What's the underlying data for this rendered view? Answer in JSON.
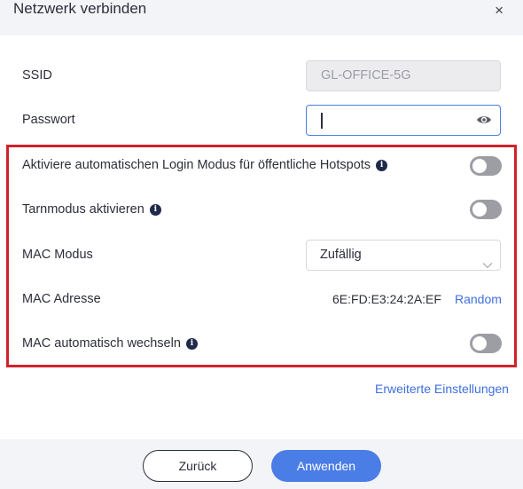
{
  "dialog": {
    "title": "Netzwerk verbinden",
    "close_glyph": "×"
  },
  "form": {
    "ssid": {
      "label": "SSID",
      "value": "GL-OFFICE-5G"
    },
    "password": {
      "label": "Passwort",
      "value": "",
      "icon": "eye-icon"
    },
    "auto_login": {
      "label": "Aktiviere automatischen Login Modus für öffentliche Hotspots",
      "enabled": false
    },
    "stealth": {
      "label": "Tarnmodus aktivieren",
      "enabled": false
    },
    "mac_mode": {
      "label": "MAC Modus",
      "selected": "Zufällig"
    },
    "mac_address": {
      "label": "MAC Adresse",
      "value": "6E:FD:E3:24:2A:EF",
      "random_label": "Random"
    },
    "mac_auto_change": {
      "label": "MAC automatisch wechseln",
      "enabled": false
    }
  },
  "advanced_link": "Erweiterte Einstellungen",
  "buttons": {
    "back": "Zurück",
    "apply": "Anwenden"
  },
  "colors": {
    "accent": "#4a7de5",
    "highlight": "#d0222b",
    "toggle_off": "#9c9ea4"
  }
}
